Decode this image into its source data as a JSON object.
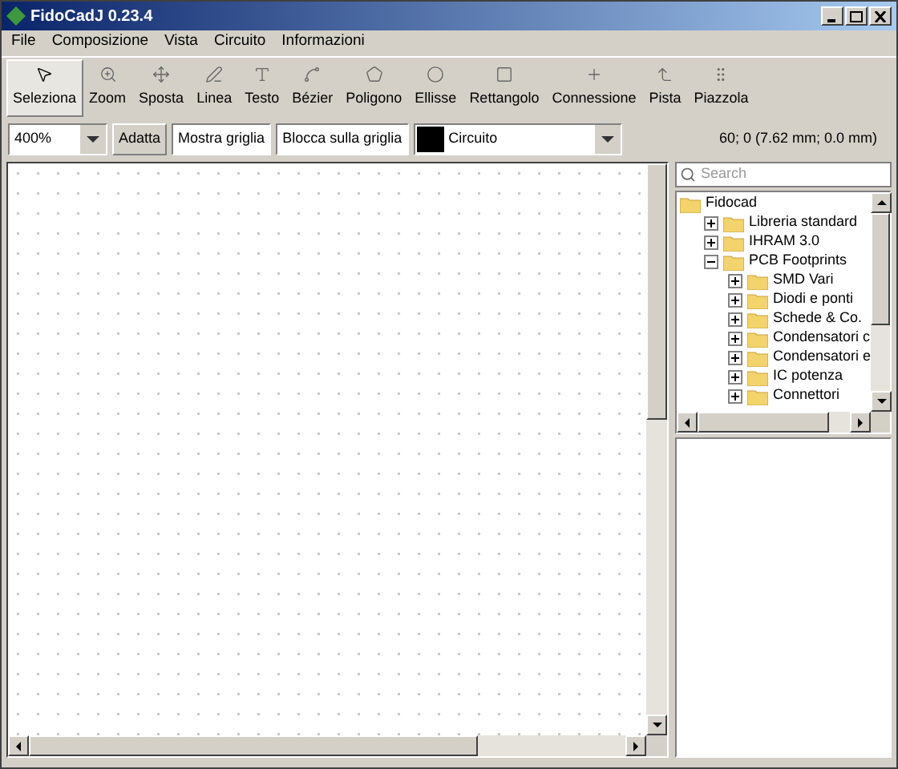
{
  "window": {
    "title": "FidoCadJ 0.23.4"
  },
  "menu": [
    "File",
    "Composizione",
    "Vista",
    "Circuito",
    "Informazioni"
  ],
  "tools": [
    {
      "label": "Seleziona",
      "selected": true
    },
    {
      "label": "Zoom",
      "selected": false
    },
    {
      "label": "Sposta",
      "selected": false
    },
    {
      "label": "Linea",
      "selected": false
    },
    {
      "label": "Testo",
      "selected": false
    },
    {
      "label": "Bézier",
      "selected": false
    },
    {
      "label": "Poligono",
      "selected": false
    },
    {
      "label": "Ellisse",
      "selected": false
    },
    {
      "label": "Rettangolo",
      "selected": false
    },
    {
      "label": "Connessione",
      "selected": false
    },
    {
      "label": "Pista",
      "selected": false
    },
    {
      "label": "Piazzola",
      "selected": false
    }
  ],
  "zoom": {
    "value": "400%"
  },
  "buttons": [
    {
      "label": "Adatta",
      "on": false
    },
    {
      "label": "Mostra griglia",
      "on": true
    },
    {
      "label": "Blocca sulla griglia",
      "on": true
    }
  ],
  "layer": {
    "name": "Circuito",
    "color": "#000000"
  },
  "coordinates": "60; 0 (7.62 mm; 0.0 mm)",
  "search": {
    "placeholder": "Search"
  },
  "tree": {
    "label": "Fidocad",
    "children": [
      {
        "label": "Libreria standard",
        "expanded": false
      },
      {
        "label": "IHRAM 3.0",
        "expanded": false
      },
      {
        "label": "PCB Footprints",
        "expanded": true,
        "children": [
          {
            "label": "SMD Vari",
            "expanded": false
          },
          {
            "label": "Diodi e ponti",
            "expanded": false
          },
          {
            "label": "Schede & Co.",
            "expanded": false
          },
          {
            "label": "Condensatori c",
            "expanded": false
          },
          {
            "label": "Condensatori e",
            "expanded": false
          },
          {
            "label": "IC potenza",
            "expanded": false
          },
          {
            "label": "Connettori",
            "expanded": false
          }
        ]
      }
    ]
  }
}
